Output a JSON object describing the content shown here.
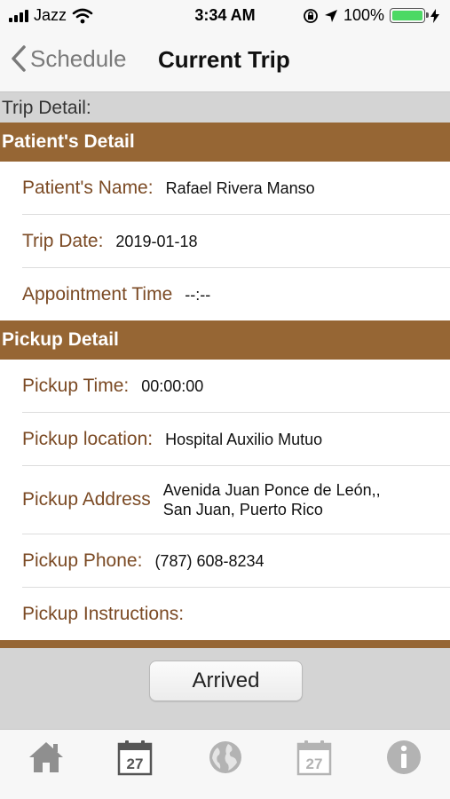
{
  "status_bar": {
    "carrier": "Jazz",
    "time": "3:34 AM",
    "battery": "100%",
    "battery_level": 1.0
  },
  "nav": {
    "back_label": "Schedule",
    "title": "Current Trip"
  },
  "trip_detail_label": "Trip Detail:",
  "sections": {
    "patient": {
      "header": "Patient's Detail",
      "rows": [
        {
          "label": "Patient's Name:",
          "value": "Rafael Rivera Manso"
        },
        {
          "label": "Trip Date:",
          "value": "2019-01-18"
        },
        {
          "label": "Appointment Time",
          "value": "--:--"
        }
      ]
    },
    "pickup": {
      "header": "Pickup Detail",
      "rows": [
        {
          "label": "Pickup Time:",
          "value": "00:00:00"
        },
        {
          "label": "Pickup location:",
          "value": "Hospital Auxilio Mutuo"
        },
        {
          "label": "Pickup Address",
          "value_line1": "Avenida Juan Ponce de León,,",
          "value_line2": "San Juan, Puerto Rico"
        },
        {
          "label": "Pickup Phone:",
          "value": "(787) 608-8234"
        },
        {
          "label": "Pickup Instructions:",
          "value": ""
        }
      ]
    }
  },
  "actions": {
    "arrived_label": "Arrived"
  },
  "tab_bar": {
    "icons": [
      "home-icon",
      "calendar-icon",
      "globe-icon",
      "calendar-faded-icon",
      "info-icon"
    ],
    "calendar_day": "27"
  },
  "colors": {
    "section_header": "#966634",
    "label_text": "#7b4a24",
    "battery_fill": "#4cd964",
    "tab_icon_active": "#555555",
    "tab_icon_inactive": "#b3b3b3"
  }
}
